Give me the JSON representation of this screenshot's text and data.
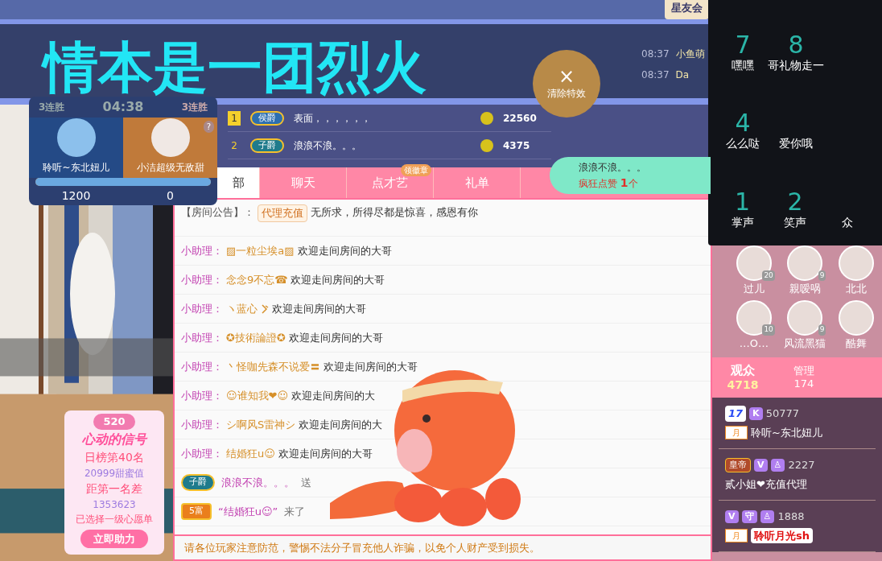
{
  "header": {
    "banner": "情本是一团烈火",
    "club_tab": "星友会",
    "messages": [
      {
        "time": "08:37",
        "user": "小鱼萌"
      },
      {
        "time": "08:37",
        "user": "Da"
      }
    ]
  },
  "clear_effects": {
    "icon": "×",
    "label": "清除特效"
  },
  "pk": {
    "left_streak": "3连胜",
    "timer": "04:38",
    "right_streak": "3连胜",
    "help": "?",
    "left_name": "聆听~东北妞儿",
    "right_name": "小洁超级无敌甜",
    "level": 1,
    "left_score": "1200",
    "right_score": "0"
  },
  "ranking": [
    {
      "rank": "1",
      "badge": "侯爵",
      "name": "表面，，，，，，",
      "coins": "22560"
    },
    {
      "rank": "2",
      "badge": "子爵",
      "name": "浪浪不浪。。。",
      "coins": "4375"
    }
  ],
  "like_bubble": {
    "name": "浪浪不浪。。。",
    "action": "疯狂点赞",
    "count": "1",
    "unit": "个"
  },
  "tabs": [
    {
      "label": "部",
      "selected": true
    },
    {
      "label": "聊天",
      "selected": false
    },
    {
      "label": "点才艺",
      "selected": false,
      "badge": "领徽章"
    },
    {
      "label": "礼单",
      "selected": false
    }
  ],
  "announcement": {
    "prefix": "【房间公告】：",
    "tag": "代理充值",
    "text": "无所求，所得尽都是惊喜，感恩有你"
  },
  "chat": [
    {
      "kind": "assistant",
      "speaker": "小助理：",
      "user": "▨一粒尘埃a▨",
      "text": "欢迎走间房间的大哥"
    },
    {
      "kind": "assistant",
      "speaker": "小助理：",
      "user": "念念9不忘☎",
      "text": "欢迎走间房间的大哥"
    },
    {
      "kind": "assistant",
      "speaker": "小助理：",
      "user": "ヽ蓝心",
      "text": "欢迎走间房间的大哥",
      "mark": true
    },
    {
      "kind": "assistant",
      "speaker": "小助理：",
      "user": "✪技術論證✪",
      "text": "欢迎走间房间的大哥"
    },
    {
      "kind": "assistant",
      "speaker": "小助理：",
      "user": "丶怪咖先森不说爱〓",
      "text": "欢迎走间房间的大哥"
    },
    {
      "kind": "assistant",
      "speaker": "小助理：",
      "user": "☺谁知我❤☺",
      "text": "欢迎走间房间的大"
    },
    {
      "kind": "assistant",
      "speaker": "小助理：",
      "user": "シ啊风S雷神シ",
      "text": "欢迎走间房间的大"
    },
    {
      "kind": "assistant",
      "speaker": "小助理：",
      "user": "结婚狂u☺",
      "text": "欢迎走间房间的大哥"
    },
    {
      "kind": "gift",
      "badge": "子爵",
      "user": "浪浪不浪。。。",
      "text": "送"
    },
    {
      "kind": "enter",
      "badge": "5富",
      "user": "“结婚狂u☺”",
      "text": "来了"
    }
  ],
  "notice": "请各位玩家注意防范，警惕不法分子冒充他人诈骗，以免个人财产受到损失。",
  "event_card": {
    "number": "520",
    "title": "心动的信号",
    "rank": "日榜第40名",
    "score": "20999甜蜜值",
    "gap_label": "距第一名差",
    "gap": "1353623",
    "wish": "已选择一级心愿单",
    "button": "立即助力"
  },
  "gift_rows": [
    [
      {
        "hotkey": "7",
        "name": "嘿嘿"
      },
      {
        "hotkey": "8",
        "name": "哥礼物走一"
      }
    ],
    [
      {
        "hotkey": "4",
        "name": "么么哒"
      },
      {
        "name": "爱你哦"
      }
    ],
    [
      {
        "hotkey": "1",
        "name": "掌声"
      },
      {
        "hotkey": "2",
        "name": "笑声"
      },
      {
        "name": "众"
      }
    ]
  ],
  "guards": [
    {
      "name": "过儿",
      "level": "20"
    },
    {
      "name": "親嗳㖞",
      "level": "9"
    },
    {
      "name": "北北"
    },
    {
      "name": "…O…",
      "level": "10"
    },
    {
      "name": "风流黑猫",
      "level": "9"
    },
    {
      "name": "酷舞"
    }
  ],
  "audience_tabs": [
    {
      "label": "观众",
      "count": "4718",
      "selected": true
    },
    {
      "label": "管理",
      "count": "174",
      "selected": false
    }
  ],
  "viewers": [
    {
      "level": "17",
      "tags": [
        "K"
      ],
      "points": "50777",
      "badge": "月",
      "name": "聆听~东北妞儿",
      "highlight": false
    },
    {
      "title": "皇帝",
      "tags": [
        "V",
        "♙"
      ],
      "points": "2227",
      "name": "贰小姐❤充值代理",
      "highlight": false
    },
    {
      "tags": [
        "V",
        "守",
        "♙"
      ],
      "points": "1888",
      "badge": "月",
      "name": "聆听月光sh",
      "highlight": true
    }
  ]
}
